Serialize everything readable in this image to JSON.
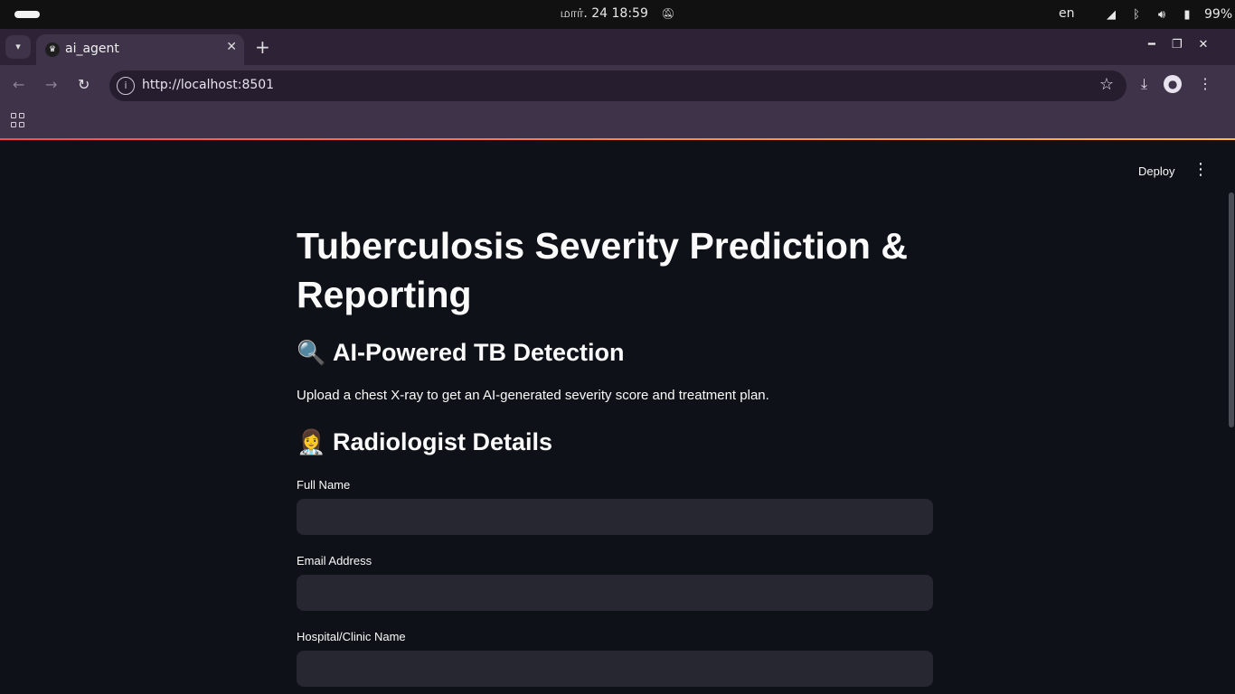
{
  "os": {
    "clock": "மார். 24  18:59",
    "language": "en",
    "battery": "99%",
    "icons": [
      "bell-muted-icon",
      "signal-icon",
      "bluetooth-icon",
      "volume-icon",
      "battery-icon"
    ]
  },
  "browser": {
    "tab_title": "ai_agent",
    "url": "http://localhost:8501"
  },
  "app": {
    "deploy_label": "Deploy",
    "title": "Tuberculosis Severity Prediction & Reporting",
    "detection_heading": {
      "emoji": "🔍",
      "text": "AI-Powered TB Detection"
    },
    "description": "Upload a chest X-ray to get an AI-generated severity score and treatment plan.",
    "radiologist_heading": {
      "emoji": "👩‍⚕️",
      "text": "Radiologist Details"
    },
    "fields": [
      {
        "label": "Full Name",
        "value": ""
      },
      {
        "label": "Email Address",
        "value": ""
      },
      {
        "label": "Hospital/Clinic Name",
        "value": ""
      }
    ]
  },
  "colors": {
    "background": "#0e1117",
    "input_background": "#262730",
    "accent_gradient_start": "#ff4b4b",
    "accent_gradient_end": "#ffbd45",
    "browser_chrome": "#3e3349"
  }
}
